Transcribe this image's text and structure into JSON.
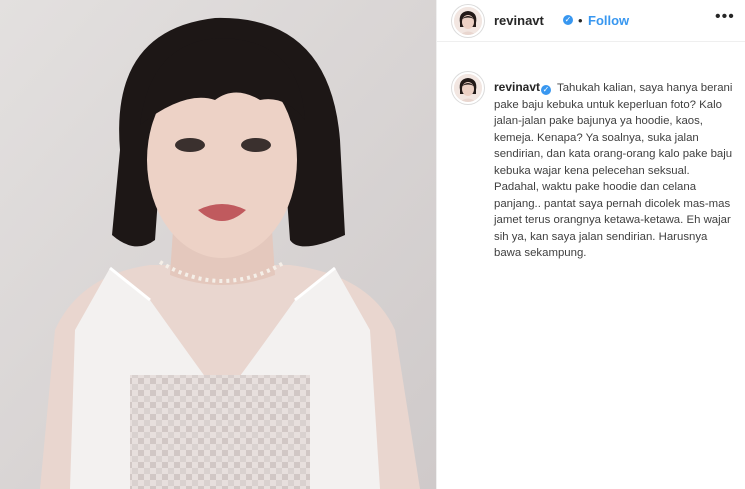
{
  "post": {
    "username": "revinavt",
    "dot": "•",
    "follow_label": "Follow",
    "more_label": "•••",
    "verified_icon": "✓",
    "caption": "Tahukah kalian, saya hanya berani pake baju kebuka untuk keperluan foto? Kalo jalan-jalan pake bajunya ya hoodie, kaos, kemeja. Kenapa? Ya soalnya, suka jalan sendirian, dan kata orang-orang kalo pake baju kebuka wajar kena pelecehan seksual. Padahal, waktu pake hoodie dan celana panjang.. pantat saya pernah dicolek mas-mas jamet terus orangnya ketawa-ketawa. Eh wajar sih ya, kan saya jalan sendirian. Harusnya bawa sekampung."
  },
  "colors": {
    "accent": "#3897f0",
    "text": "#262626",
    "border": "#efefef"
  }
}
